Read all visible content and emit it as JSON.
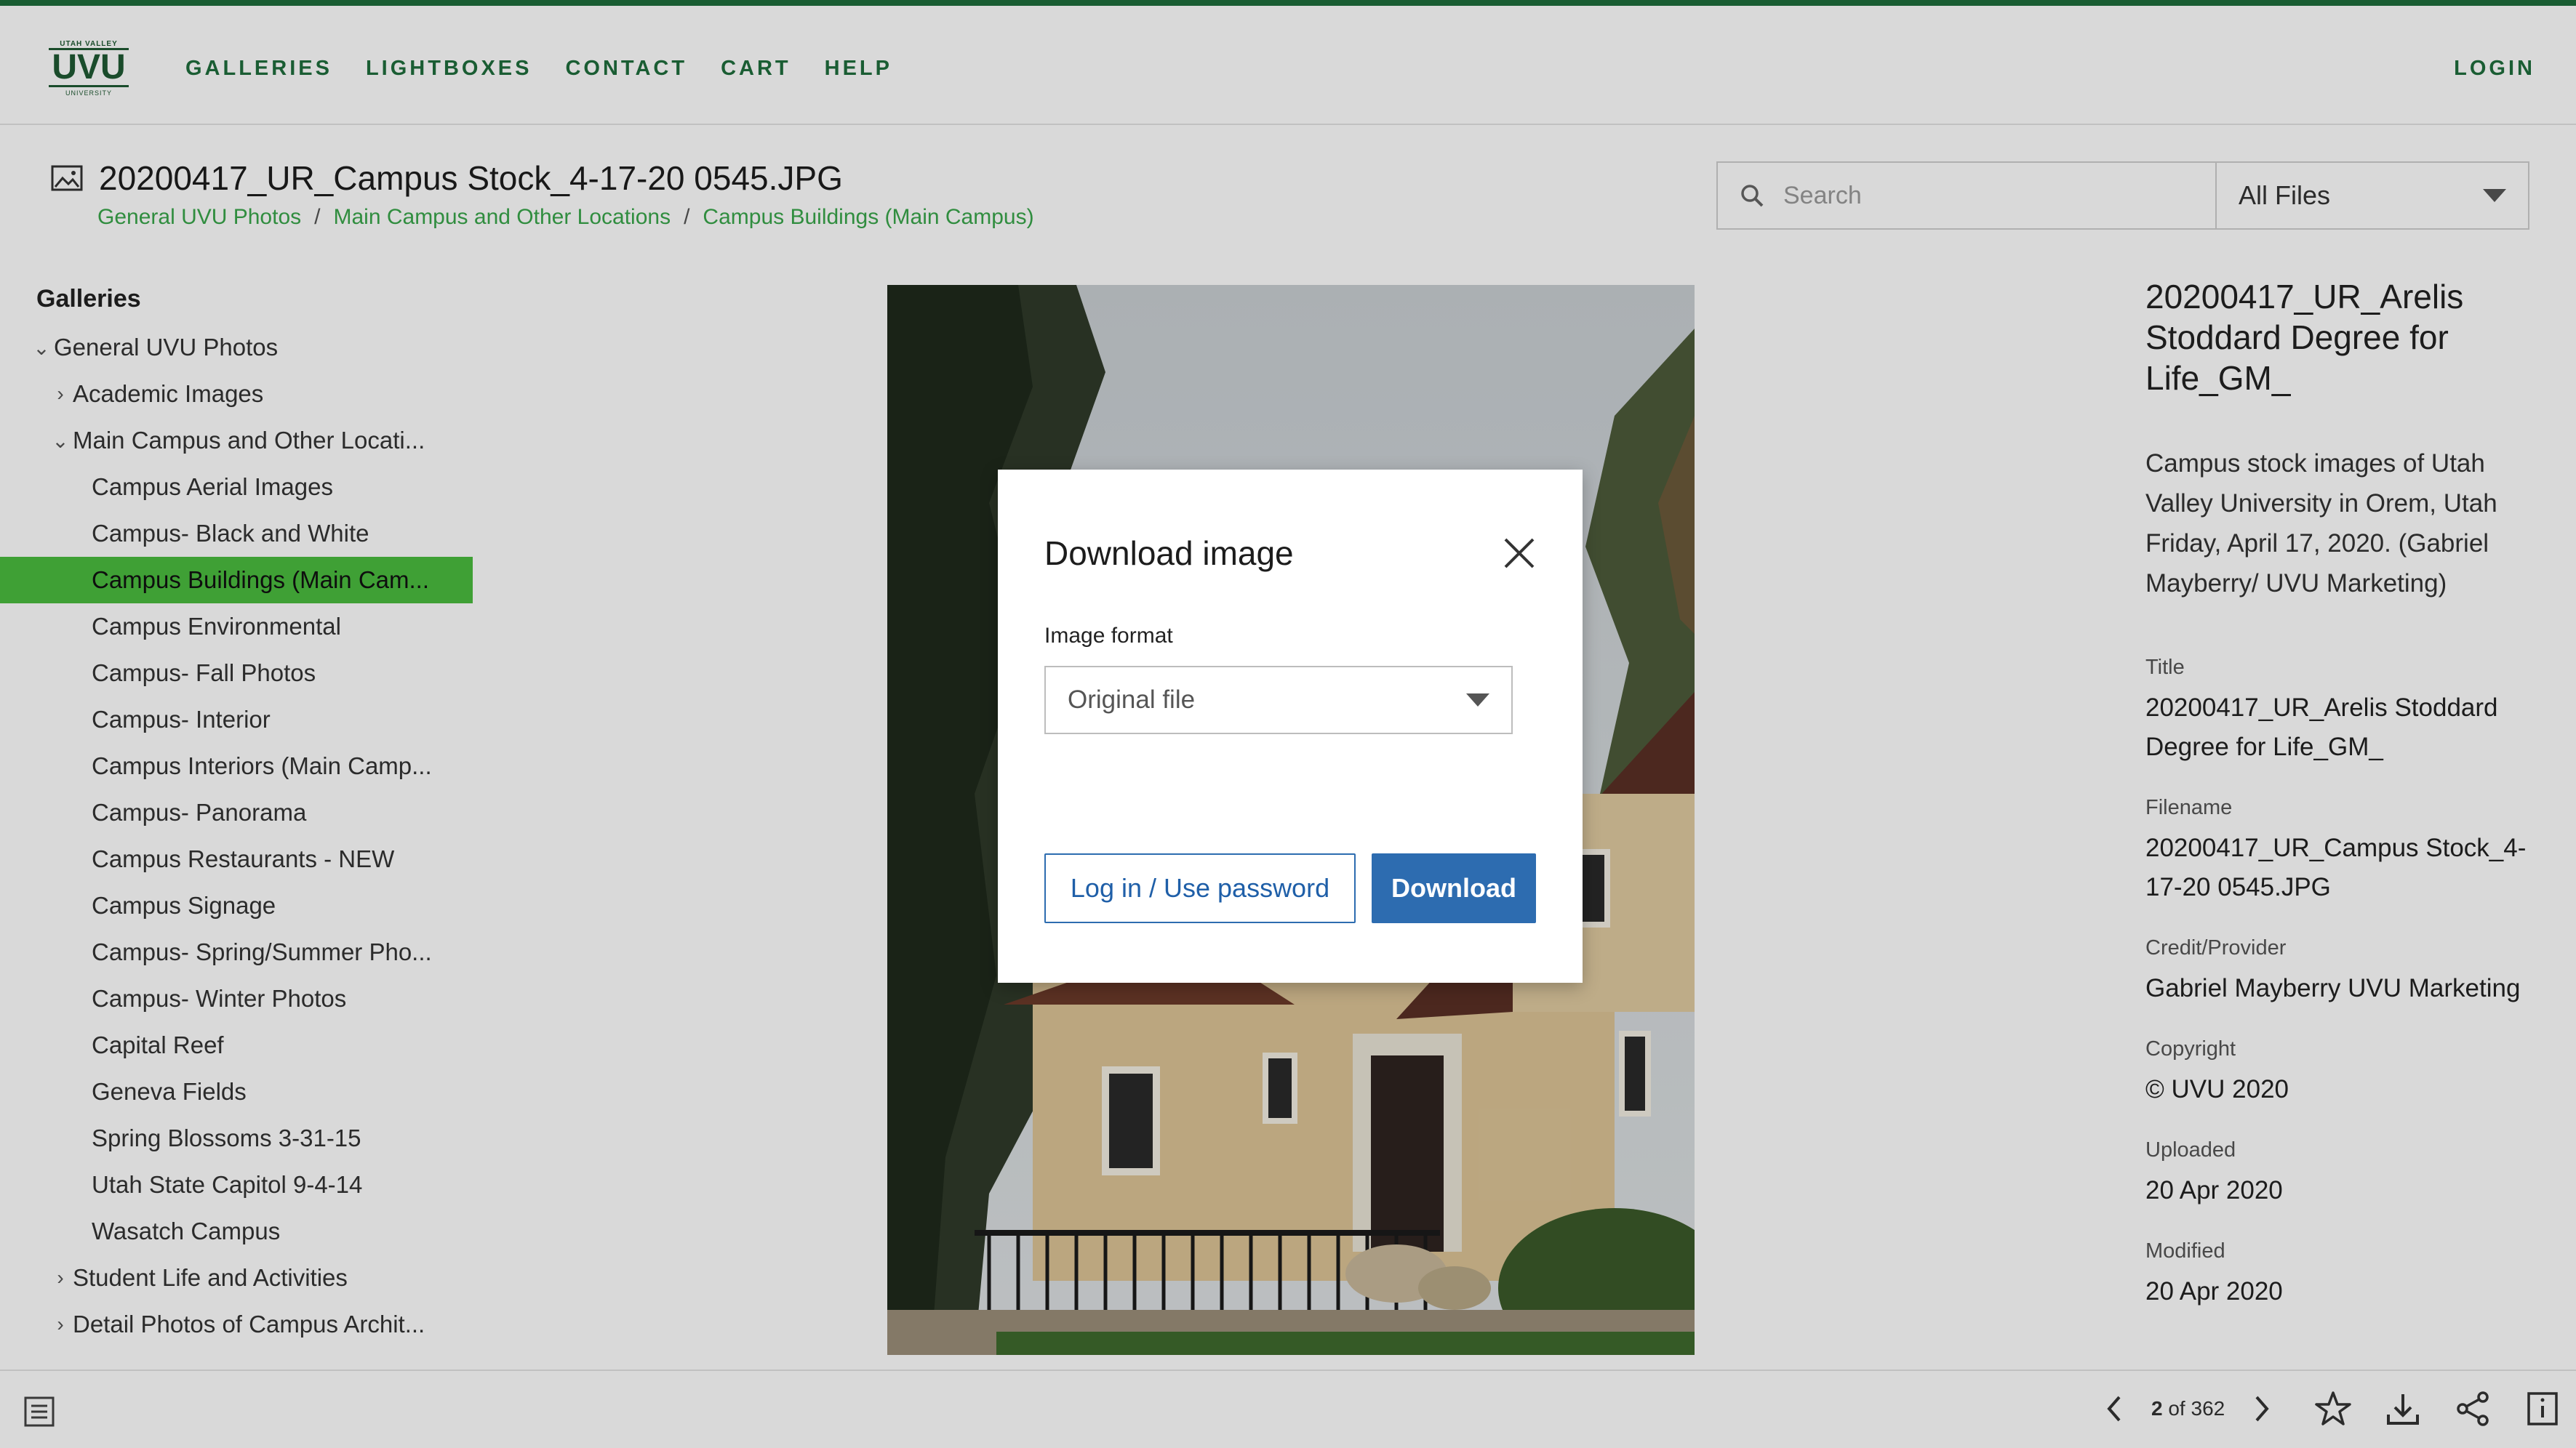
{
  "nav": {
    "logo_small_text": "UTAH VALLEY",
    "logo_text": "UVU",
    "logo_sub_text": "UNIVERSITY",
    "items": [
      "GALLERIES",
      "LIGHTBOXES",
      "CONTACT",
      "CART",
      "HELP"
    ],
    "login": "LOGIN"
  },
  "header": {
    "title": "20200417_UR_Campus Stock_4-17-20 0545.JPG",
    "breadcrumb": [
      "General UVU Photos",
      "Main Campus and Other Locations",
      "Campus Buildings (Main Campus)"
    ],
    "breadcrumb_sep": "/"
  },
  "search": {
    "placeholder": "Search",
    "filter": "All Files"
  },
  "sidebar": {
    "heading": "Galleries",
    "items": [
      {
        "label": "General UVU Photos",
        "chevron": "expanded"
      },
      {
        "label": "Academic Images",
        "chevron": "collapsed"
      },
      {
        "label": "Main Campus and Other Locati...",
        "chevron": "expanded"
      },
      {
        "label": "Campus Aerial Images"
      },
      {
        "label": "Campus- Black and White"
      },
      {
        "label": "Campus Buildings (Main Cam...",
        "active": true
      },
      {
        "label": "Campus Environmental"
      },
      {
        "label": "Campus- Fall Photos"
      },
      {
        "label": "Campus- Interior"
      },
      {
        "label": "Campus Interiors (Main Camp..."
      },
      {
        "label": "Campus- Panorama"
      },
      {
        "label": "Campus Restaurants - NEW"
      },
      {
        "label": "Campus Signage"
      },
      {
        "label": "Campus- Spring/Summer Pho..."
      },
      {
        "label": "Campus- Winter Photos"
      },
      {
        "label": "Capital Reef"
      },
      {
        "label": "Geneva Fields"
      },
      {
        "label": "Spring Blossoms 3-31-15"
      },
      {
        "label": "Utah State Capitol 9-4-14"
      },
      {
        "label": "Wasatch Campus"
      },
      {
        "label": "Student Life and Activities",
        "chevron": "collapsed"
      },
      {
        "label": "Detail Photos of Campus Archit...",
        "chevron": "collapsed"
      }
    ]
  },
  "details": {
    "title": "20200417_UR_Arelis Stoddard Degree for Life_GM_",
    "description": "Campus stock images of Utah Valley University in Orem, Utah Friday, April 17, 2020. (Gabriel Mayberry/ UVU Marketing)",
    "fields": [
      {
        "label": "Title",
        "value": "20200417_UR_Arelis Stoddard Degree for Life_GM_"
      },
      {
        "label": "Filename",
        "value": "20200417_UR_Campus Stock_4-17-20 0545.JPG"
      },
      {
        "label": "Credit/Provider",
        "value": "Gabriel Mayberry UVU Marketing"
      },
      {
        "label": "Copyright",
        "value": "© UVU 2020"
      },
      {
        "label": "Uploaded",
        "value": "20 Apr 2020"
      },
      {
        "label": "Modified",
        "value": "20 Apr 2020"
      }
    ]
  },
  "modal": {
    "title": "Download image",
    "format_label": "Image format",
    "format_value": "Original file",
    "login_button": "Log in / Use password",
    "download_button": "Download"
  },
  "bottom": {
    "current": "2",
    "of_text": "of 362"
  },
  "colors": {
    "brand_green": "#1f6e3d",
    "link_green": "#39a64a",
    "active_green": "#4bbd3f",
    "button_blue": "#2d6cb0"
  },
  "icons": [
    "image-icon",
    "search-icon",
    "chevron-down-icon",
    "close-icon",
    "list-icon",
    "chevron-left-icon",
    "chevron-right-icon",
    "star-icon",
    "download-icon",
    "share-icon",
    "info-icon"
  ]
}
